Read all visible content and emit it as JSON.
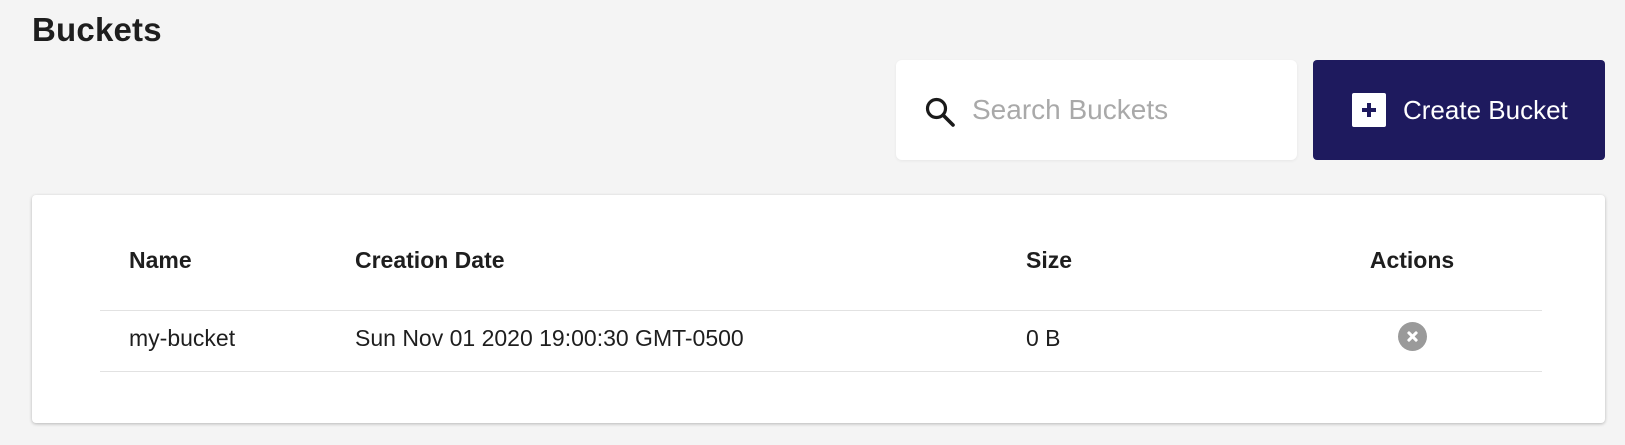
{
  "page": {
    "title": "Buckets"
  },
  "toolbar": {
    "search_placeholder": "Search Buckets",
    "search_value": "",
    "create_label": "Create Bucket",
    "create_color": "#1e1a5e"
  },
  "table": {
    "columns": {
      "name": "Name",
      "creation_date": "Creation Date",
      "size": "Size",
      "actions": "Actions"
    },
    "rows": [
      {
        "name": "my-bucket",
        "creation_date": "Sun Nov 01 2020 19:00:30 GMT-0500",
        "size": "0 B",
        "action_icon": "delete-icon"
      }
    ]
  },
  "icons": {
    "search": "search-icon",
    "create": "plus-icon",
    "delete": "delete-icon"
  }
}
